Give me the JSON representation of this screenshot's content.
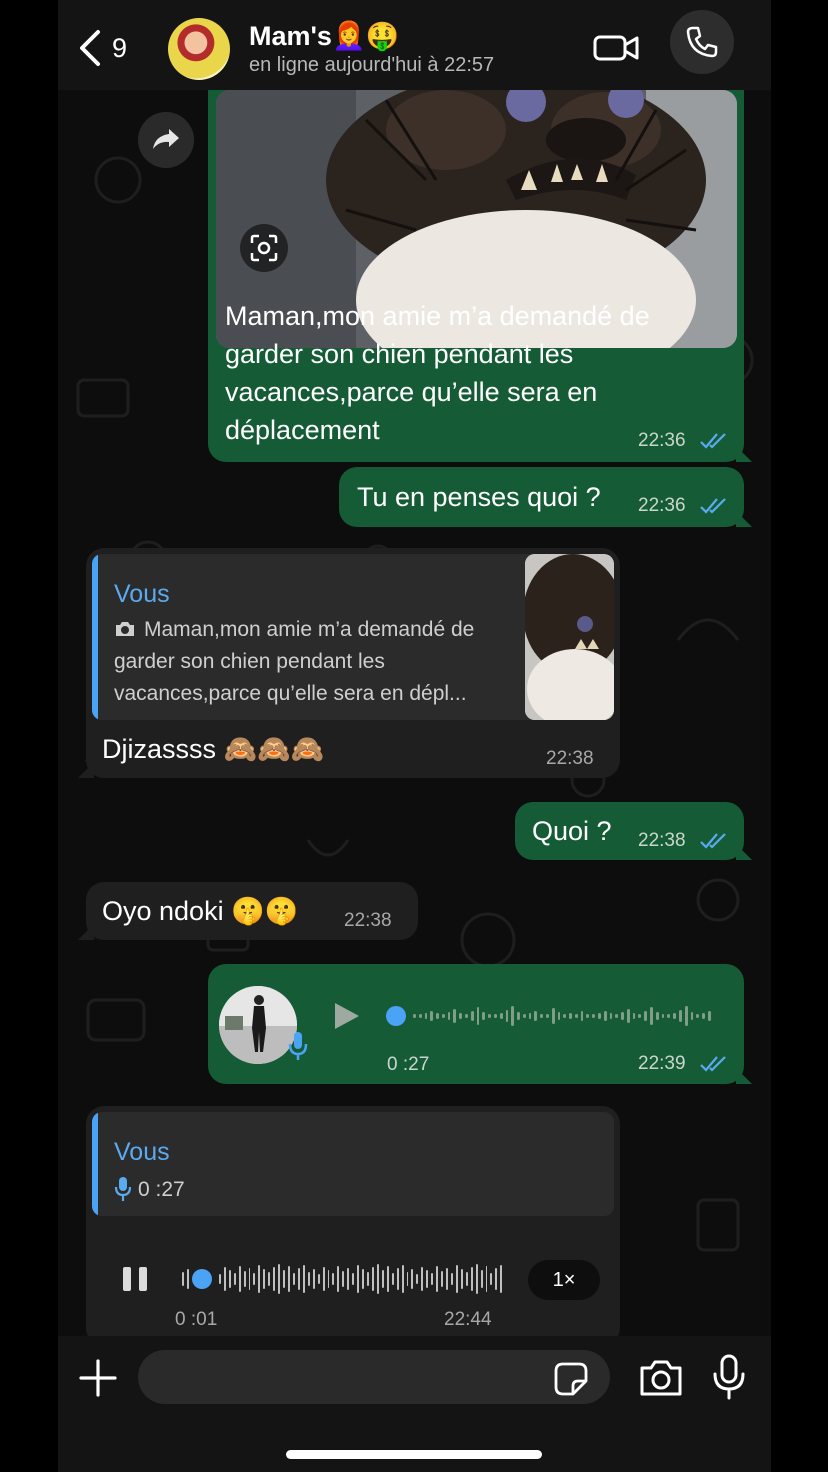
{
  "header": {
    "back_count": "9",
    "contact_name": "Mam's👩‍🦰🤑",
    "status": "en ligne aujourd'hui à 22:57"
  },
  "messages": {
    "m1": {
      "text_lines": [
        "Maman,mon amie m’a demandé de",
        "garder son chien pendant les",
        "vacances,parce qu’elle sera en",
        "déplacement"
      ],
      "time": "22:36"
    },
    "m2": {
      "text": "Tu en penses quoi ?",
      "time": "22:36"
    },
    "m3": {
      "quote_author": "Vous",
      "quote_lines": [
        "Maman,mon amie m’a demandé de",
        "garder son chien pendant les",
        "vacances,parce qu’elle sera en dépl..."
      ],
      "text": "Djizassss 🙈🙈🙈",
      "time": "22:38"
    },
    "m4": {
      "text": "Quoi ?",
      "time": "22:38"
    },
    "m5": {
      "text": "Oyo ndoki 🤫🤫",
      "time": "22:38"
    },
    "m6": {
      "duration": "0 :27",
      "time": "22:39",
      "progress": 0.0
    },
    "m7": {
      "quote_author": "Vous",
      "quote_duration": "0 :27",
      "elapsed": "0 :01",
      "time": "22:44",
      "speed": "1×",
      "progress": 0.04
    }
  },
  "colors": {
    "outgoing": "#155c36",
    "incoming": "#1f1f1f",
    "accent_blue": "#4aa3f5",
    "read_ticks": "#5aaaf0"
  },
  "icons": [
    "back-chevron-icon",
    "video-camera-icon",
    "phone-icon",
    "forward-icon",
    "scan-icon",
    "camera-small-icon",
    "play-icon",
    "mic-icon",
    "pause-icon",
    "plus-icon",
    "sticker-icon",
    "camera-icon"
  ]
}
